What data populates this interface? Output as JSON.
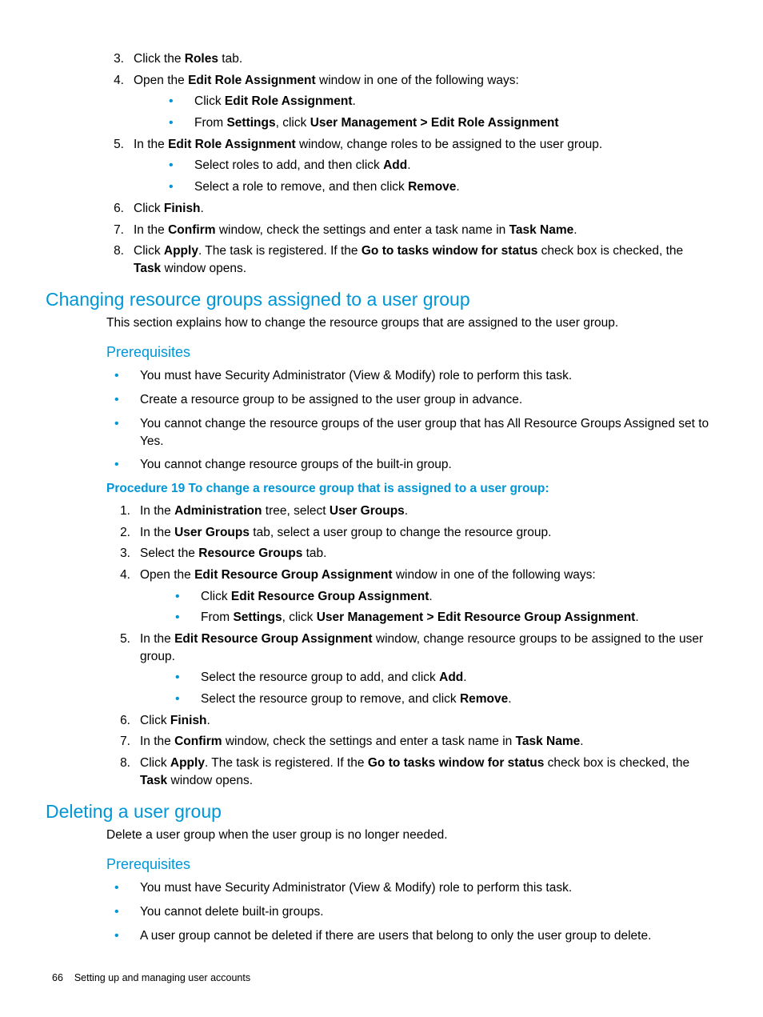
{
  "top_steps": {
    "s3": {
      "pre": "Click the ",
      "b1": "Roles",
      "post": " tab."
    },
    "s4": {
      "pre": "Open the ",
      "b1": "Edit Role Assignment",
      "post": " window in one of the following ways:"
    },
    "s4_sub": {
      "a": {
        "pre": "Click ",
        "b1": "Edit Role Assignment",
        "post": "."
      },
      "b": {
        "pre": "From ",
        "b1": "Settings",
        "mid": ", click ",
        "b2": "User Management > Edit Role Assignment"
      }
    },
    "s5": {
      "pre": "In the ",
      "b1": "Edit Role Assignment",
      "post": " window, change roles to be assigned to the user group."
    },
    "s5_sub": {
      "a": {
        "pre": "Select roles to add, and then click ",
        "b1": "Add",
        "post": "."
      },
      "b": {
        "pre": "Select a role to remove, and then click ",
        "b1": "Remove",
        "post": "."
      }
    },
    "s6": {
      "pre": "Click ",
      "b1": "Finish",
      "post": "."
    },
    "s7": {
      "pre": "In the ",
      "b1": "Confirm",
      "mid": " window, check the settings and enter a task name in ",
      "b2": "Task Name",
      "post": "."
    },
    "s8": {
      "pre": "Click ",
      "b1": "Apply",
      "mid1": ". The task is registered. If the ",
      "b2": "Go to tasks window for status",
      "mid2": " check box is checked, the ",
      "b3": "Task",
      "post": " window opens."
    }
  },
  "section_changing": {
    "title": "Changing resource groups assigned to a user group",
    "intro": "This section explains how to change the resource groups that are assigned to the user group.",
    "prereq_title": "Prerequisites",
    "prereqs": [
      "You must have Security Administrator (View & Modify) role to perform this task.",
      "Create a resource group to be assigned to the user group in advance.",
      "You cannot change the resource groups of the user group that has All Resource Groups Assigned set to Yes.",
      "You cannot change resource groups of the built-in group."
    ],
    "proc_title": "Procedure 19 To change a resource group that is assigned to a user group:",
    "steps": {
      "s1": {
        "pre": "In the ",
        "b1": "Administration",
        "mid": " tree, select ",
        "b2": "User Groups",
        "post": "."
      },
      "s2": {
        "pre": "In the ",
        "b1": "User Groups",
        "post": " tab, select a user group to change the resource group."
      },
      "s3": {
        "pre": "Select the ",
        "b1": "Resource Groups",
        "post": " tab."
      },
      "s4": {
        "pre": "Open the ",
        "b1": "Edit Resource Group Assignment",
        "post": " window in one of the following ways:"
      },
      "s4_sub": {
        "a": {
          "pre": "Click ",
          "b1": "Edit Resource Group Assignment",
          "post": "."
        },
        "b": {
          "pre": "From ",
          "b1": "Settings",
          "mid": ", click ",
          "b2": "User Management > Edit Resource Group Assignment",
          "post": "."
        }
      },
      "s5": {
        "pre": "In the ",
        "b1": "Edit Resource Group Assignment",
        "post": " window, change resource groups to be assigned to the user group."
      },
      "s5_sub": {
        "a": {
          "pre": "Select the resource group to add, and click ",
          "b1": "Add",
          "post": "."
        },
        "b": {
          "pre": "Select the resource group to remove, and click ",
          "b1": "Remove",
          "post": "."
        }
      },
      "s6": {
        "pre": "Click ",
        "b1": "Finish",
        "post": "."
      },
      "s7": {
        "pre": "In the ",
        "b1": "Confirm",
        "mid": " window, check the settings and enter a task name in ",
        "b2": "Task Name",
        "post": "."
      },
      "s8": {
        "pre": "Click ",
        "b1": "Apply",
        "mid1": ". The task is registered. If the ",
        "b2": "Go to tasks window for status",
        "mid2": " check box is checked, the ",
        "b3": "Task",
        "post": " window opens."
      }
    }
  },
  "section_deleting": {
    "title": "Deleting a user group",
    "intro": "Delete a user group when the user group is no longer needed.",
    "prereq_title": "Prerequisites",
    "prereqs": [
      "You must have Security Administrator (View & Modify) role to perform this task.",
      "You cannot delete built-in groups.",
      "A user group cannot be deleted if there are users that belong to only the user group to delete."
    ]
  },
  "footer": {
    "page_num": "66",
    "section": "Setting up and managing user accounts"
  },
  "nums": {
    "n1": "1.",
    "n2": "2.",
    "n3": "3.",
    "n4": "4.",
    "n5": "5.",
    "n6": "6.",
    "n7": "7.",
    "n8": "8."
  }
}
